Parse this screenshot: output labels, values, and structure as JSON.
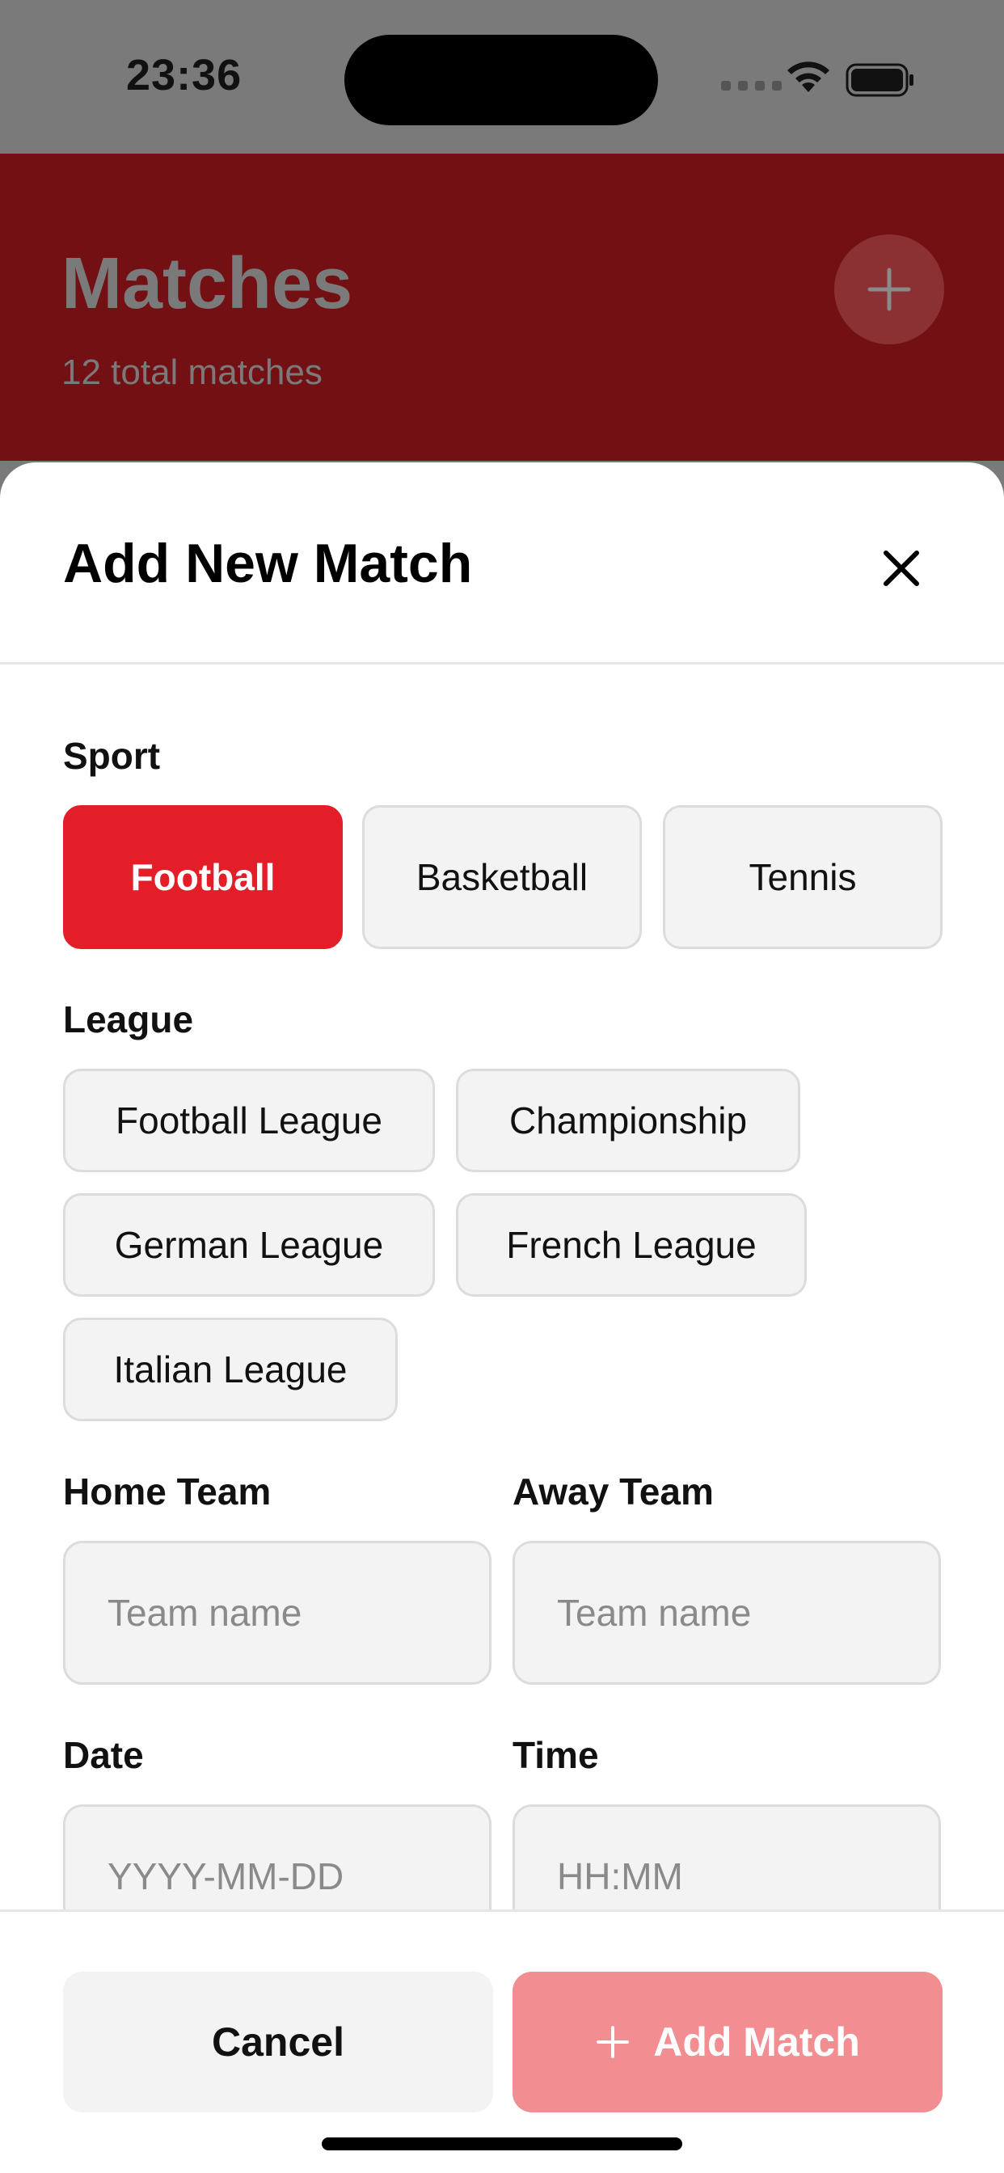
{
  "status_bar": {
    "time": "23:36"
  },
  "app_header": {
    "title": "Matches",
    "subtitle": "12 total matches",
    "add_icon": "plus-icon"
  },
  "sheet": {
    "title": "Add New Match",
    "close_icon": "close-icon",
    "sport": {
      "label": "Sport",
      "options": [
        "Football",
        "Basketball",
        "Tennis"
      ],
      "selected": "Football"
    },
    "league": {
      "label": "League",
      "options": [
        "Football League",
        "Championship",
        "German League",
        "French League",
        "Italian League"
      ]
    },
    "home_team": {
      "label": "Home Team",
      "placeholder": "Team name"
    },
    "away_team": {
      "label": "Away Team",
      "placeholder": "Team name"
    },
    "date": {
      "label": "Date",
      "placeholder": "YYYY-MM-DD"
    },
    "time": {
      "label": "Time",
      "placeholder": "HH:MM"
    }
  },
  "footer": {
    "cancel_label": "Cancel",
    "add_label": "Add Match",
    "add_icon": "plus-icon"
  },
  "colors": {
    "accent": "#e31e28",
    "accent_disabled": "#f28e92",
    "header_dimmed": "#731014"
  }
}
